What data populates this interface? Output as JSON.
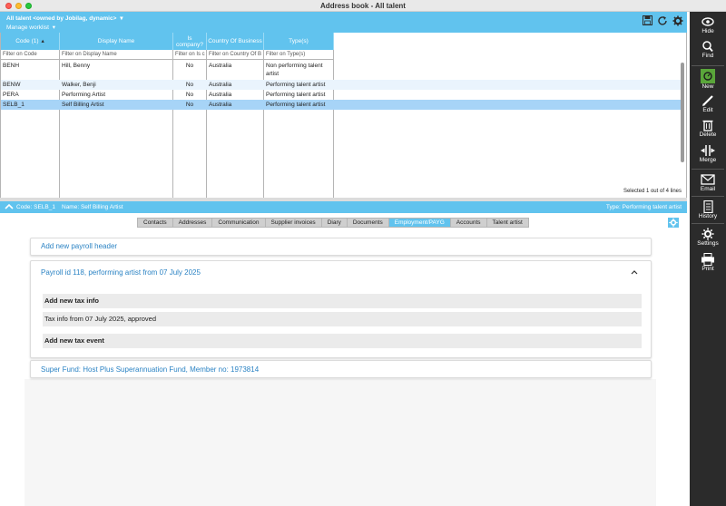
{
  "window": {
    "title": "Address book - All talent"
  },
  "top_header": {
    "worklist_title": "All talent <owned by Jobilag, dynamic>",
    "manage_worklist": "Manage worklist"
  },
  "grid": {
    "columns": [
      {
        "label": "Code (1)"
      },
      {
        "label": "Display Name"
      },
      {
        "label": "Is company?"
      },
      {
        "label": "Country Of Business"
      },
      {
        "label": "Type(s)"
      }
    ],
    "filters": [
      "Filter on Code",
      "Filter on Display Name",
      "Filter on Is c",
      "Filter on Country Of B",
      "Filter on Type(s)"
    ],
    "rows": [
      {
        "code": "BENH",
        "display_name": "Hill, Benny",
        "is_company": "No",
        "country": "Australia",
        "types": "Non performing talent artist"
      },
      {
        "code": "BENW",
        "display_name": "Walker, Benji",
        "is_company": "No",
        "country": "Australia",
        "types": "Performing talent artist"
      },
      {
        "code": "PERA",
        "display_name": "Performing Artist",
        "is_company": "No",
        "country": "Australia",
        "types": "Performing talent artist"
      },
      {
        "code": "SELB_1",
        "display_name": "Self Billing Artist",
        "is_company": "No",
        "country": "Australia",
        "types": "Performing talent artist"
      }
    ],
    "status": "Selected 1 out of 4 lines"
  },
  "detail": {
    "code": "Code: SELB_1",
    "name": "Name: Self Billing Artist",
    "type": "Type: Performing talent artist"
  },
  "tabs": [
    "Contacts",
    "Addresses",
    "Communication",
    "Supplier invoices",
    "Diary",
    "Documents",
    "Employment/PAYG",
    "Accounts",
    "Talent artist"
  ],
  "active_tab": "Employment/PAYG",
  "payroll": {
    "add_header": "Add new payroll header",
    "payroll_title": "Payroll id 118, performing artist from 07 July 2025",
    "add_tax_info": "Add new tax info",
    "tax_info": "Tax info from 07 July 2025, approved",
    "add_tax_event": "Add new tax event",
    "super_fund": "Super Fund: Host Plus Superannuation Fund, Member no: 1973814"
  },
  "toolbar": {
    "hide": "Hide",
    "find": "Find",
    "new": "New",
    "edit": "Edit",
    "delete": "Delete",
    "merge": "Merge",
    "email": "Email",
    "history": "History",
    "settings": "Settings",
    "print": "Print"
  },
  "colors": {
    "accent": "#61c3ee",
    "selected_row": "#a7d4f7",
    "link": "#2b83c4",
    "toolbar_bg": "#2b2b2b",
    "new_button": "#5aa63a"
  }
}
